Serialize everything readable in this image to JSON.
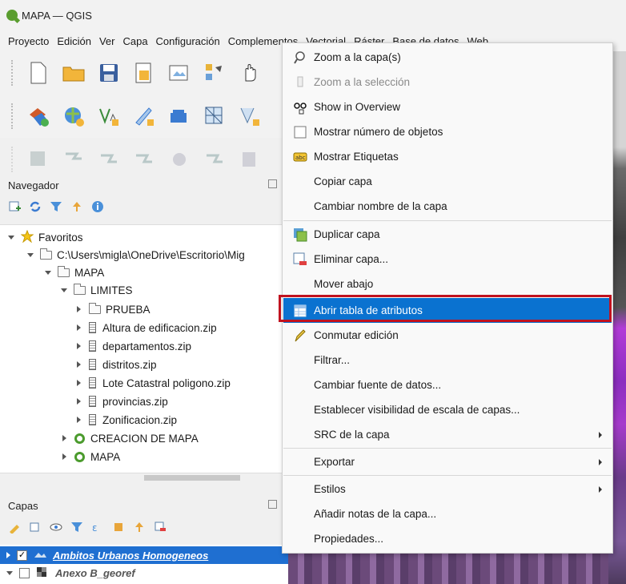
{
  "window": {
    "title": "MAPA — QGIS",
    "app_icon": "qgis-logo-icon"
  },
  "menubar": {
    "items": [
      {
        "label": "Proyecto"
      },
      {
        "label": "Edición"
      },
      {
        "label": "Ver"
      },
      {
        "label": "Capa"
      },
      {
        "label": "Configuración"
      },
      {
        "label": "Complementos"
      },
      {
        "label": "Vectorial"
      },
      {
        "label": "Ráster"
      },
      {
        "label": "Base de datos"
      },
      {
        "label": "Web"
      }
    ]
  },
  "browser_panel": {
    "title": "Navegador",
    "tree": [
      {
        "label": "Favoritos",
        "icon": "star-icon"
      },
      {
        "label": "C:\\Users\\migla\\OneDrive\\Escritorio\\Mig",
        "icon": "folder-icon"
      },
      {
        "label": "MAPA",
        "icon": "folder-icon"
      },
      {
        "label": "LIMITES",
        "icon": "folder-icon"
      },
      {
        "label": "PRUEBA",
        "icon": "folder-icon"
      },
      {
        "label": "Altura de edificacion.zip",
        "icon": "zip-icon"
      },
      {
        "label": "departamentos.zip",
        "icon": "zip-icon"
      },
      {
        "label": "distritos.zip",
        "icon": "zip-icon"
      },
      {
        "label": "Lote Catastral poligono.zip",
        "icon": "zip-icon"
      },
      {
        "label": "provincias.zip",
        "icon": "zip-icon"
      },
      {
        "label": "Zonificacion.zip",
        "icon": "zip-icon"
      },
      {
        "label": "CREACION DE MAPA",
        "icon": "qgis-project-icon"
      },
      {
        "label": "MAPA",
        "icon": "qgis-project-icon"
      }
    ]
  },
  "layers_panel": {
    "title": "Capas",
    "layers": [
      {
        "label": "Ambitos Urbanos Homogeneos",
        "checked": true,
        "selected": true
      },
      {
        "label": "Anexo B_georef",
        "checked": false,
        "selected": false
      }
    ]
  },
  "context_menu": {
    "items": [
      {
        "label": "Zoom a la capa(s)",
        "icon": "zoom-layer-icon"
      },
      {
        "label": "Zoom a la selección",
        "icon": "zoom-selection-icon",
        "disabled": true
      },
      {
        "label": "Show in Overview",
        "icon": "overview-icon"
      },
      {
        "label": "Mostrar número de objetos",
        "icon": "checkbox-icon"
      },
      {
        "label": "Mostrar Etiquetas",
        "icon": "labels-icon"
      },
      {
        "label": "Copiar capa",
        "icon": ""
      },
      {
        "label": "Cambiar nombre de la capa",
        "icon": ""
      },
      {
        "label": "Duplicar capa",
        "icon": "duplicate-layer-icon"
      },
      {
        "label": "Eliminar capa...",
        "icon": "remove-layer-icon"
      },
      {
        "label": "Mover abajo",
        "icon": ""
      },
      {
        "label": "Abrir tabla de atributos",
        "icon": "attribute-table-icon",
        "highlighted": true
      },
      {
        "label": "Conmutar edición",
        "icon": "pencil-icon"
      },
      {
        "label": "Filtrar...",
        "icon": ""
      },
      {
        "label": "Cambiar fuente de datos...",
        "icon": ""
      },
      {
        "label": "Establecer visibilidad de escala de capas...",
        "icon": ""
      },
      {
        "label": "SRC de la capa",
        "icon": "",
        "submenu": true
      },
      {
        "label": "Exportar",
        "icon": "",
        "submenu": true
      },
      {
        "label": "Estilos",
        "icon": "",
        "submenu": true
      },
      {
        "label": "Añadir notas de la capa...",
        "icon": ""
      },
      {
        "label": "Propiedades...",
        "icon": ""
      }
    ]
  },
  "colors": {
    "highlight": "#0a72d0",
    "annotation_box": "#c0121f",
    "layer_selected": "#1f6fd1"
  }
}
